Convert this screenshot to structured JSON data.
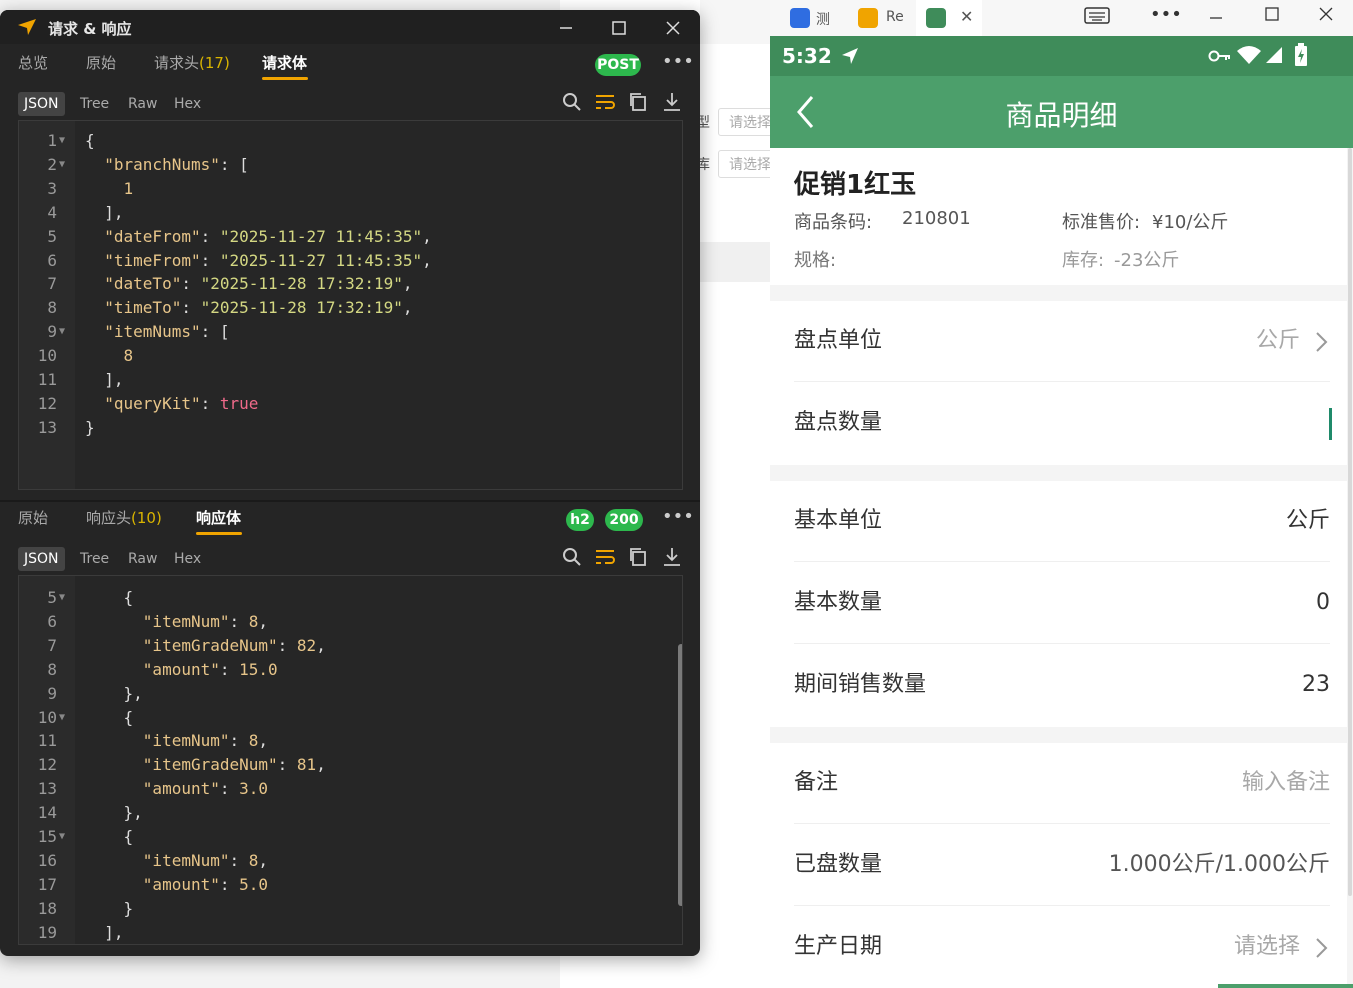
{
  "debugger": {
    "title": "请求 & 响应",
    "request_tabs": [
      {
        "label": "总览"
      },
      {
        "label": "原始"
      },
      {
        "label": "请求头",
        "count": "(17)"
      },
      {
        "label": "请求体"
      }
    ],
    "method_badge": "POST",
    "formats": [
      "JSON",
      "Tree",
      "Raw",
      "Hex"
    ],
    "request_lines": [
      {
        "n": "1",
        "fold": true,
        "html": "{"
      },
      {
        "n": "2",
        "fold": true,
        "html": "  <span class='k'>\"branchNums\"</span>: ["
      },
      {
        "n": "3",
        "fold": false,
        "html": "    <span class='n'>1</span>"
      },
      {
        "n": "4",
        "fold": false,
        "html": "  ],"
      },
      {
        "n": "5",
        "fold": false,
        "html": "  <span class='k'>\"dateFrom\"</span>: <span class='s'>\"2025-11-27 11:45:35\"</span>,"
      },
      {
        "n": "6",
        "fold": false,
        "html": "  <span class='k'>\"timeFrom\"</span>: <span class='s'>\"2025-11-27 11:45:35\"</span>,"
      },
      {
        "n": "7",
        "fold": false,
        "html": "  <span class='k'>\"dateTo\"</span>: <span class='s'>\"2025-11-28 17:32:19\"</span>,"
      },
      {
        "n": "8",
        "fold": false,
        "html": "  <span class='k'>\"timeTo\"</span>: <span class='s'>\"2025-11-28 17:32:19\"</span>,"
      },
      {
        "n": "9",
        "fold": true,
        "html": "  <span class='k'>\"itemNums\"</span>: ["
      },
      {
        "n": "10",
        "fold": false,
        "html": "    <span class='n'>8</span>"
      },
      {
        "n": "11",
        "fold": false,
        "html": "  ],"
      },
      {
        "n": "12",
        "fold": false,
        "html": "  <span class='k'>\"queryKit\"</span>: <span class='b'>true</span>"
      },
      {
        "n": "13",
        "fold": false,
        "html": "}"
      }
    ],
    "response_tabs": [
      {
        "label": "原始"
      },
      {
        "label": "响应头",
        "count": "(10)"
      },
      {
        "label": "响应体"
      }
    ],
    "protocol_badge": "h2",
    "status_badge": "200",
    "response_lines": [
      {
        "n": "5",
        "fold": true,
        "html": "    {"
      },
      {
        "n": "6",
        "fold": false,
        "html": "      <span class='k'>\"itemNum\"</span>: <span class='n'>8</span>,"
      },
      {
        "n": "7",
        "fold": false,
        "html": "      <span class='k'>\"itemGradeNum\"</span>: <span class='n'>82</span>,"
      },
      {
        "n": "8",
        "fold": false,
        "html": "      <span class='k'>\"amount\"</span>: <span class='n'>15.0</span>"
      },
      {
        "n": "9",
        "fold": false,
        "html": "    },"
      },
      {
        "n": "10",
        "fold": true,
        "html": "    {"
      },
      {
        "n": "11",
        "fold": false,
        "html": "      <span class='k'>\"itemNum\"</span>: <span class='n'>8</span>,"
      },
      {
        "n": "12",
        "fold": false,
        "html": "      <span class='k'>\"itemGradeNum\"</span>: <span class='n'>81</span>,"
      },
      {
        "n": "13",
        "fold": false,
        "html": "      <span class='k'>\"amount\"</span>: <span class='n'>3.0</span>"
      },
      {
        "n": "14",
        "fold": false,
        "html": "    },"
      },
      {
        "n": "15",
        "fold": true,
        "html": "    {"
      },
      {
        "n": "16",
        "fold": false,
        "html": "      <span class='k'>\"itemNum\"</span>: <span class='n'>8</span>,"
      },
      {
        "n": "17",
        "fold": false,
        "html": "      <span class='k'>\"amount\"</span>: <span class='n'>5.0</span>"
      },
      {
        "n": "18",
        "fold": false,
        "html": "    }"
      },
      {
        "n": "19",
        "fold": false,
        "html": "  ],"
      }
    ],
    "colors": {
      "accent": "#f0a400",
      "post_badge": "#2db84d",
      "status_badge": "#2db84d"
    }
  },
  "background_app": {
    "placeholder_1": "请选择",
    "placeholder_2": "请选择",
    "label_1": "型",
    "label_2": "库"
  },
  "phone": {
    "window_tabs": [
      {
        "label": "测",
        "icon": "app-icon-blue"
      },
      {
        "label": "Re",
        "icon": "app-icon-orange"
      },
      {
        "label": "",
        "icon": "android-icon",
        "active": true
      }
    ],
    "status_bar": {
      "time": "5:32"
    },
    "app_bar": {
      "title": "商品明细",
      "back": "back-icon"
    },
    "product": {
      "name": "促销1红玉",
      "barcode_label": "商品条码:",
      "barcode_value": "210801",
      "price_label": "标准售价:",
      "price_value": "¥10/公斤",
      "spec_label": "规格:",
      "spec_value": "",
      "stock_label": "库存:",
      "stock_value": "-23公斤"
    },
    "count_unit_label": "盘点单位",
    "count_unit_value": "公斤",
    "count_qty_label": "盘点数量",
    "base_unit_label": "基本单位",
    "base_unit_value": "公斤",
    "base_qty_label": "基本数量",
    "base_qty_value": "0",
    "period_sales_label": "期间销售数量",
    "period_sales_value": "23",
    "remark_label": "备注",
    "remark_placeholder": "输入备注",
    "counted_label": "已盘数量",
    "counted_value": "1.000公斤/1.000公斤",
    "prod_date_label": "生产日期",
    "prod_date_placeholder": "请选择",
    "colors": {
      "appbar": "#4c9f6b",
      "status": "#3f8c5a",
      "cursor": "#1f8a6a"
    }
  }
}
